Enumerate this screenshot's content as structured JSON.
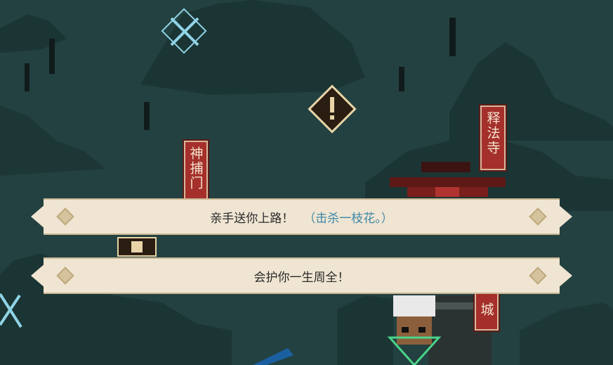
{
  "map": {
    "signs": {
      "left": "神捕门",
      "temple": "释法寺",
      "city": "城"
    },
    "alert_icon": "exclamation-diamond-icon",
    "battle_icon": "crossed-swords-icon"
  },
  "dialog": {
    "options": [
      {
        "text": "亲手送你上路！",
        "hint": "（击杀一枝花。）"
      },
      {
        "text": "会护你一生周全！",
        "hint": ""
      }
    ]
  },
  "colors": {
    "background": "#234140",
    "mountain": "#1b3534",
    "option_bg": "#efe5d2",
    "hint_text": "#3c86a8",
    "sign_red": "#a5302b"
  }
}
